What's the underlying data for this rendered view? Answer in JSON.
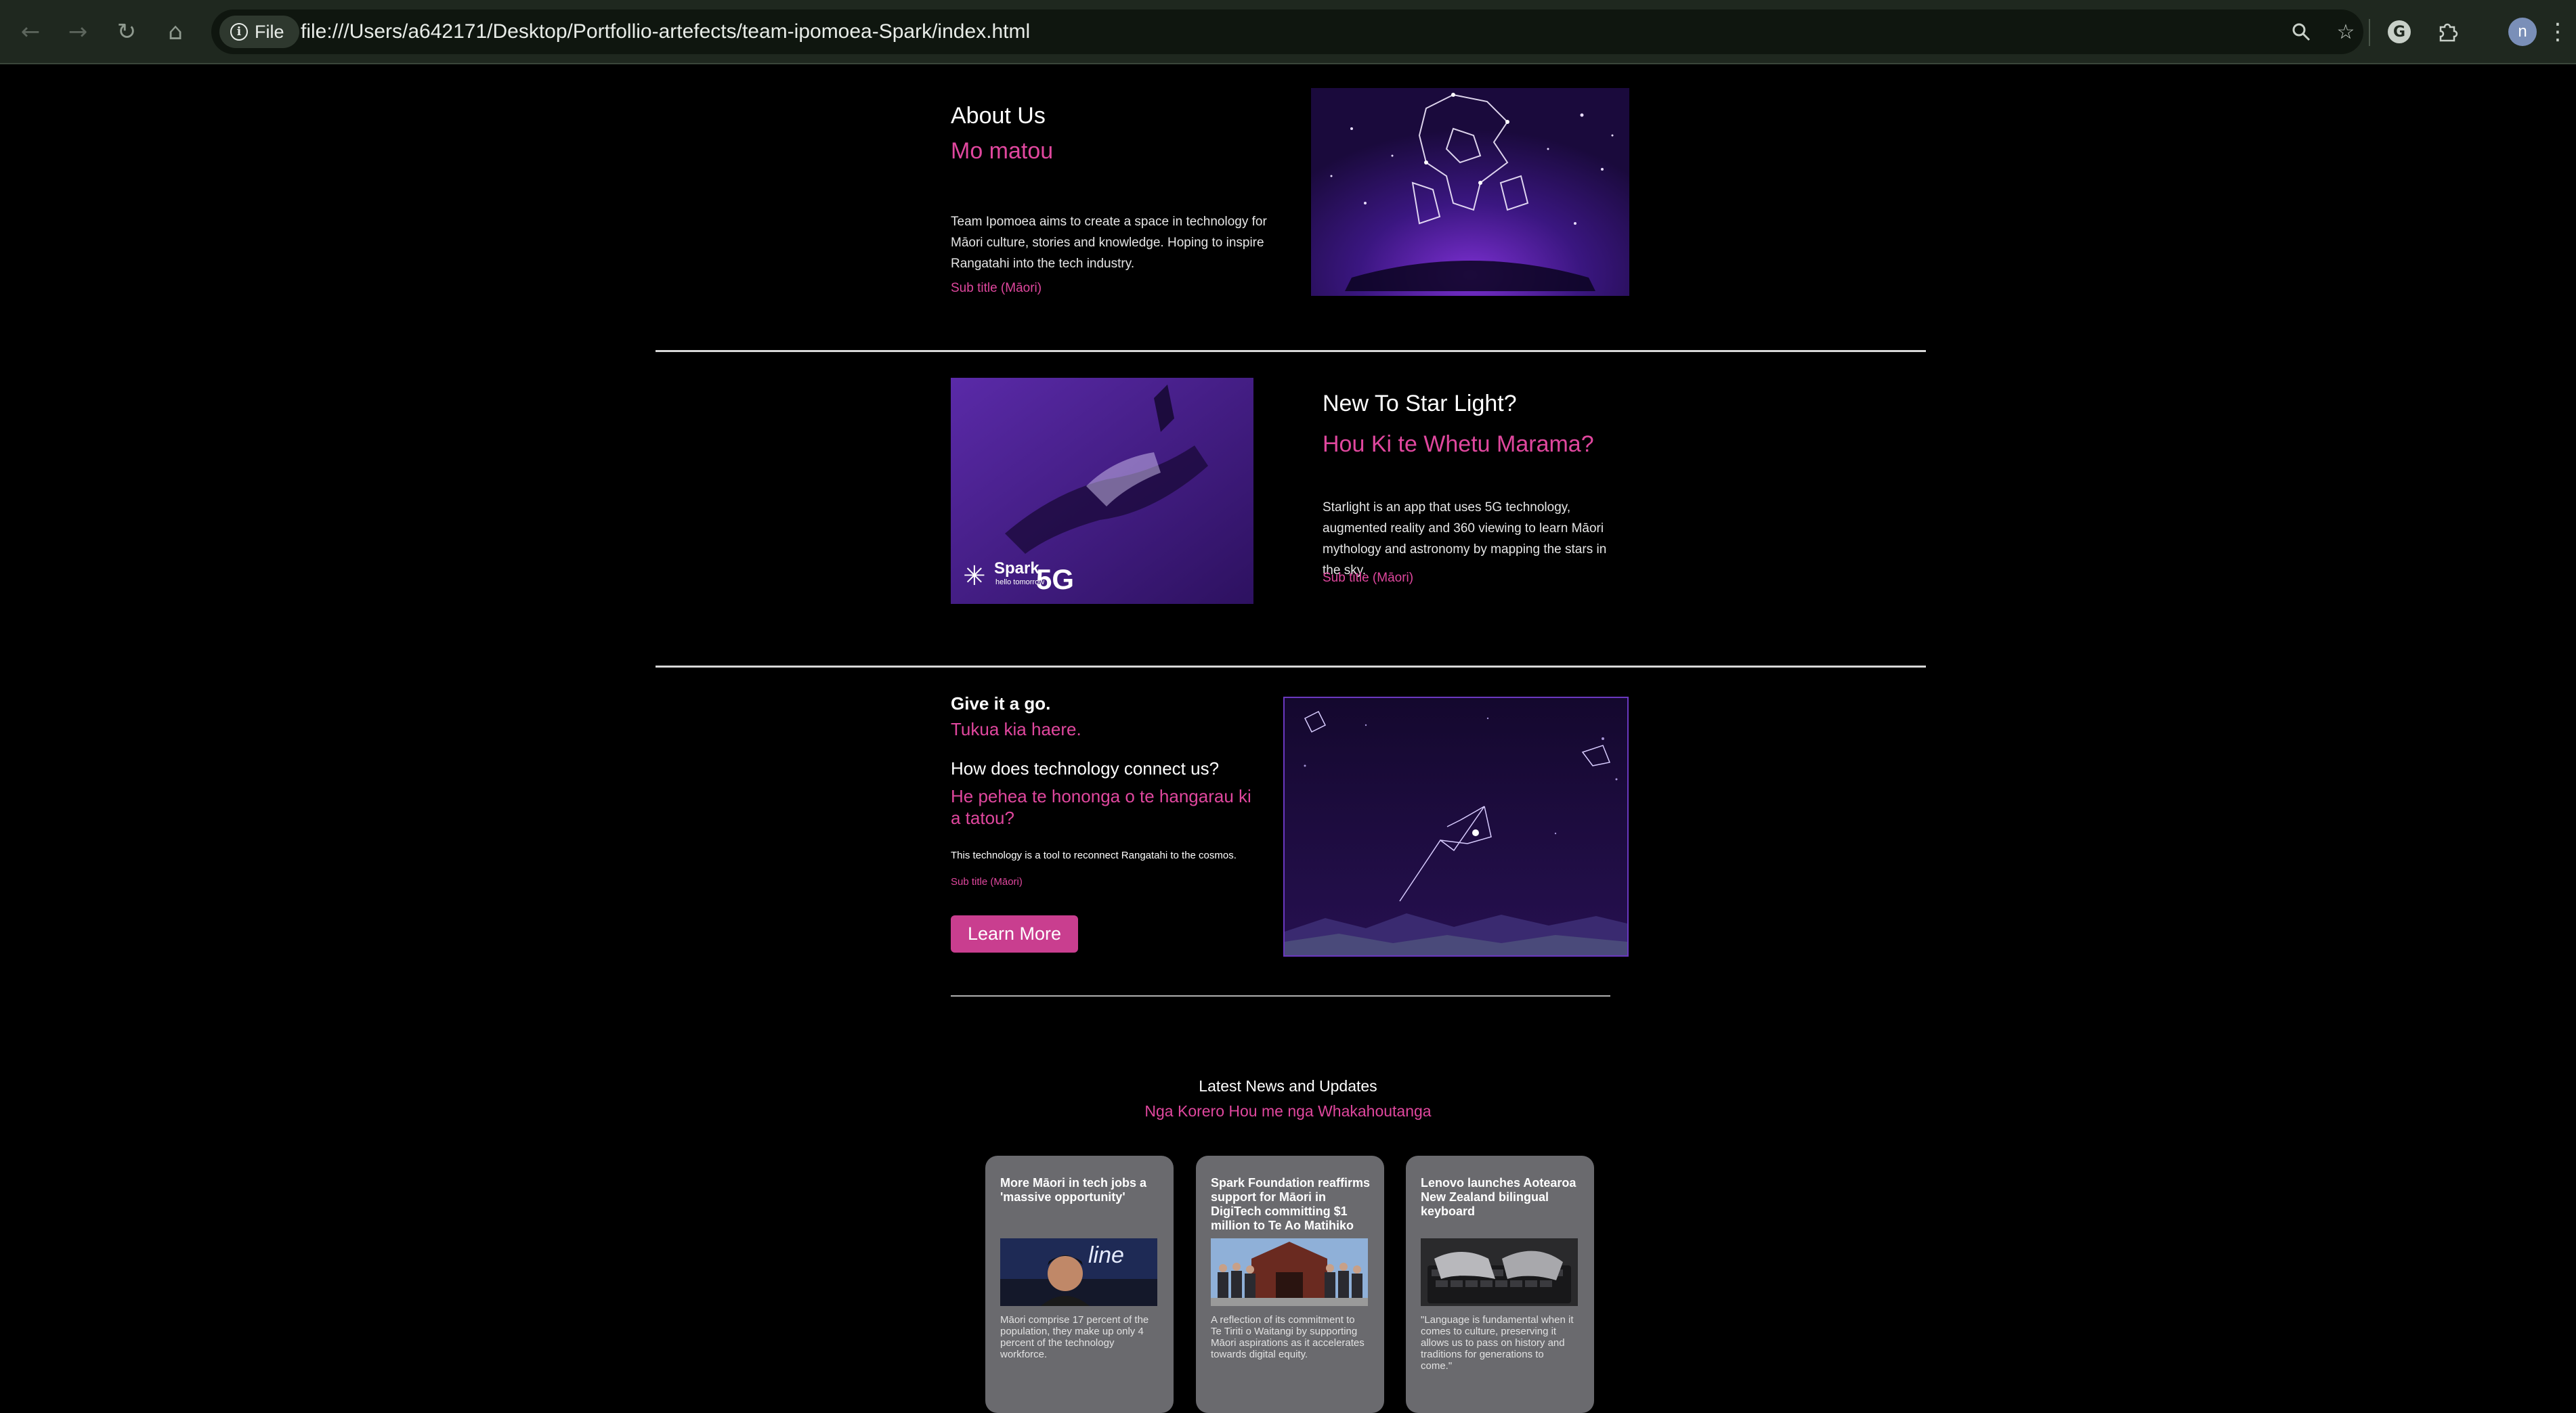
{
  "browser": {
    "chip_label": "File",
    "url": "file:///Users/a642171/Desktop/Portfollio-artefects/team-ipomoea-Spark/index.html",
    "profile_initial": "n",
    "icons": [
      "back-arrow-icon",
      "forward-arrow-icon",
      "reload-icon",
      "home-icon",
      "info-icon",
      "zoom-icon",
      "bookmark-star-icon",
      "grammarly-icon",
      "extensions-puzzle-icon",
      "menu-kebab-icon"
    ]
  },
  "about": {
    "title": "About Us",
    "title_maori": "Mo matou",
    "body": "Team Ipomoea aims to create a space in technology for Māori culture, stories and knowledge. Hoping to inspire Rangatahi into the tech industry.",
    "subtitle": "Sub title (Māori)"
  },
  "starlight": {
    "title": "New To Star Light?",
    "title_maori": "Hou Ki te Whetu Marama?",
    "body": "Starlight is an app that uses 5G technology, augmented reality and 360 viewing to learn Māori mythology and astronomy by mapping the stars in the sky.",
    "subtitle": "Sub title (Māori)",
    "image_brand": "Spark",
    "image_tagline": "hello tomorrow",
    "image_badge": "5G"
  },
  "giveitago": {
    "title": "Give it a go.",
    "title_maori": "Tukua kia haere.",
    "question": "How does technology connect us?",
    "question_maori": "He pehea te hononga o te hangarau ki a tatou?",
    "body": "This technology is a tool to reconnect Rangatahi to the cosmos.",
    "subtitle": "Sub title (Māori)",
    "button": "Learn More"
  },
  "news": {
    "title": "Latest News and Updates",
    "title_maori": "Nga Korero Hou me nga Whakahoutanga",
    "cards": [
      {
        "title": "More Māori in tech jobs a 'massive opportunity'",
        "desc": "Māori comprise 17 percent of the population, they make up only 4 percent of the technology workforce.",
        "image_text": "line"
      },
      {
        "title": "Spark Foundation reaffirms support for Māori in DigiTech committing $1 million to Te Ao Matihiko",
        "desc": "A reflection of its commitment to Te Tiriti o Waitangi by supporting Māori aspirations as it accelerates towards digital equity."
      },
      {
        "title": "Lenovo launches Aotearoa New Zealand bilingual keyboard",
        "desc": "\"Language is fundamental when it comes to culture, preserving it allows us to pass on history and traditions for generations to come.\""
      }
    ]
  },
  "colors": {
    "accent_pink": "#e0479e",
    "button_pink": "#c93e8f",
    "chrome_bg": "#1f281f",
    "card_bg": "#6a6a6e"
  }
}
